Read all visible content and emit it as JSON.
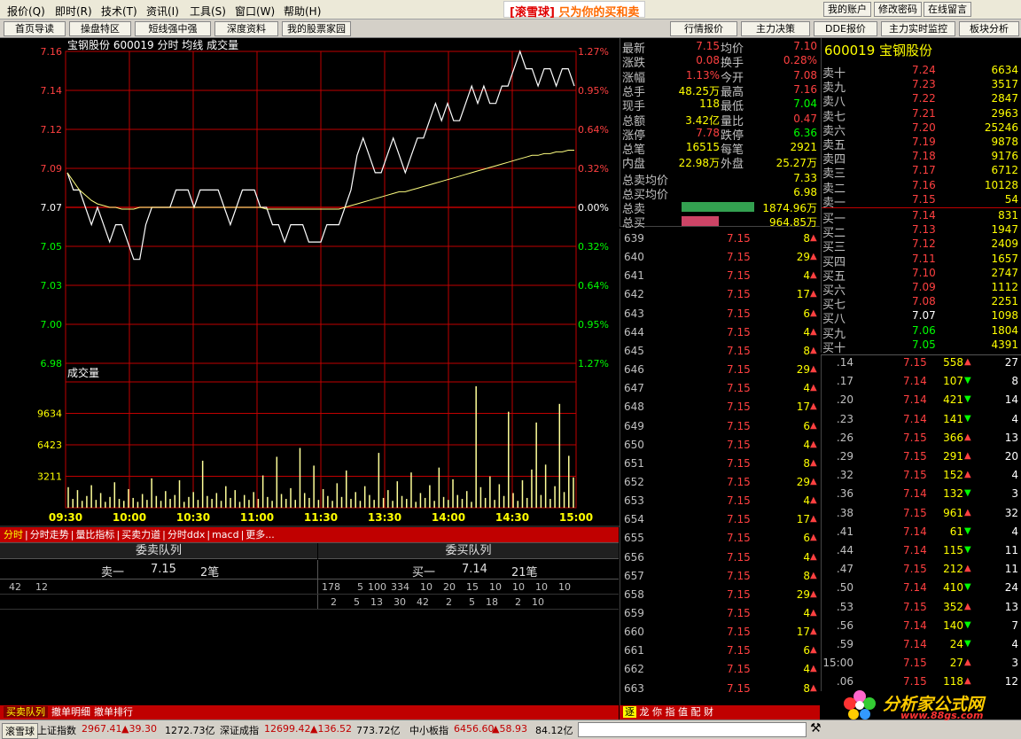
{
  "menu": [
    "报价(Q)",
    "即时(R)",
    "技术(T)",
    "资讯(I)",
    "工具(S)",
    "窗口(W)",
    "帮助(H)"
  ],
  "brand": {
    "name": "[滚雪球]",
    "slogan": "只为你的买和卖"
  },
  "account_buttons": [
    "我的账户",
    "修改密码",
    "在线留言"
  ],
  "toolbar_left": [
    "首页导读",
    "操盘特区",
    "短线强中强",
    "深度资料",
    "我的股票家园"
  ],
  "toolbar_right": [
    "行情报价",
    "主力决策",
    "DDE报价",
    "主力实时监控",
    "板块分析"
  ],
  "chart_data": [
    {
      "type": "line",
      "title": "宝钢股份 600019 分时 均线 成交量",
      "price_ticks": [
        "7.16",
        "7.14",
        "7.12",
        "7.09",
        "7.07",
        "7.05",
        "7.03",
        "7.00",
        "6.98"
      ],
      "pct_ticks": [
        "1.27%",
        "0.95%",
        "0.64%",
        "0.32%",
        "0.00%",
        "0.32%",
        "0.64%",
        "0.95%",
        "1.27%"
      ],
      "x_ticks": [
        "09:30",
        "10:00",
        "10:30",
        "11:00",
        "11:30",
        "13:30",
        "14:00",
        "14:30",
        "15:00"
      ],
      "ylim": [
        6.98,
        7.16
      ],
      "series": [
        {
          "values": [
            7.09,
            7.08,
            7.08,
            7.07,
            7.06,
            7.07,
            7.06,
            7.05,
            7.06,
            7.06,
            7.05,
            7.04,
            7.04,
            7.06,
            7.07,
            7.07,
            7.07,
            7.07,
            7.08,
            7.08,
            7.08,
            7.07,
            7.08,
            7.08,
            7.08,
            7.08,
            7.07,
            7.06,
            7.07,
            7.08,
            7.08,
            7.08,
            7.07,
            7.07,
            7.06,
            7.06,
            7.05,
            7.06,
            7.06,
            7.06,
            7.05,
            7.05,
            7.05,
            7.06,
            7.06,
            7.06,
            7.07,
            7.08,
            7.1,
            7.11,
            7.1,
            7.09,
            7.09,
            7.1,
            7.11,
            7.1,
            7.09,
            7.1,
            7.11,
            7.11,
            7.12,
            7.13,
            7.12,
            7.13,
            7.12,
            7.12,
            7.13,
            7.14,
            7.13,
            7.14,
            7.13,
            7.13,
            7.14,
            7.14,
            7.15,
            7.16,
            7.15,
            7.15,
            7.14,
            7.15,
            7.15,
            7.14,
            7.15,
            7.15,
            7.14
          ]
        },
        {
          "values": [
            7.09,
            7.085,
            7.08,
            7.077,
            7.074,
            7.072,
            7.071,
            7.07,
            7.07,
            7.069,
            7.069,
            7.069,
            7.07,
            7.07,
            7.07,
            7.07,
            7.07,
            7.07,
            7.07,
            7.07,
            7.07,
            7.07,
            7.07,
            7.07,
            7.07,
            7.07,
            7.07,
            7.07,
            7.07,
            7.07,
            7.07,
            7.07,
            7.07,
            7.069,
            7.069,
            7.069,
            7.069,
            7.069,
            7.069,
            7.069,
            7.069,
            7.069,
            7.069,
            7.069,
            7.069,
            7.069,
            7.07,
            7.071,
            7.072,
            7.073,
            7.074,
            7.075,
            7.076,
            7.077,
            7.078,
            7.079,
            7.079,
            7.08,
            7.081,
            7.082,
            7.083,
            7.084,
            7.085,
            7.086,
            7.087,
            7.088,
            7.089,
            7.09,
            7.091,
            7.092,
            7.093,
            7.094,
            7.095,
            7.096,
            7.097,
            7.098,
            7.099,
            7.1,
            7.1,
            7.101,
            7.101,
            7.102,
            7.102,
            7.103,
            7.103
          ]
        }
      ]
    },
    {
      "type": "bar",
      "title": "成交量",
      "y_ticks": [
        "9634",
        "6423",
        "3211"
      ],
      "ylim": [
        0,
        12845
      ],
      "values": [
        2100,
        900,
        1800,
        700,
        1200,
        2300,
        800,
        1500,
        600,
        1100,
        2600,
        900,
        700,
        1900,
        1000,
        600,
        1400,
        800,
        3000,
        1200,
        700,
        1700,
        900,
        1300,
        2800,
        600,
        1100,
        1600,
        800,
        4800,
        1200,
        900,
        1500,
        700,
        2200,
        1000,
        1800,
        600,
        1300,
        800,
        1600,
        900,
        3300,
        1100,
        700,
        5200,
        1400,
        900,
        2000,
        800,
        6100,
        1500,
        1000,
        4300,
        800,
        1900,
        1200,
        700,
        2500,
        1100,
        3800,
        900,
        1600,
        700,
        2200,
        1300,
        800,
        5600,
        1000,
        1800,
        700,
        2700,
        1200,
        900,
        3600,
        600,
        1500,
        1000,
        2300,
        700,
        4100,
        1100,
        800,
        2900,
        1300,
        900,
        1700,
        600,
        12400,
        2100,
        1000,
        3200,
        800,
        2400,
        1200,
        9800,
        1500,
        700,
        2800,
        1000,
        3900,
        8700,
        1300,
        4400,
        900,
        2200,
        10600,
        1600,
        5300,
        3100
      ]
    }
  ],
  "tabs_mid": [
    "分时",
    "分时走势",
    "量比指标",
    "买卖力道",
    "分时ddx",
    "macd",
    "更多..."
  ],
  "queue": {
    "sell_title": "委卖队列",
    "buy_title": "委买队列",
    "sell_label": "卖一",
    "sell_price": "7.15",
    "sell_count": "2笔",
    "buy_label": "买一",
    "buy_price": "7.14",
    "buy_count": "21笔",
    "sell_row": [
      "42",
      "12"
    ],
    "buy_row1": [
      "178",
      "5",
      "100",
      "334",
      "10",
      "20",
      "15",
      "10",
      "10",
      "10",
      "10"
    ],
    "buy_row2": [
      "2",
      "5",
      "13",
      "30",
      "42",
      "2",
      "5",
      "18",
      "2",
      "10"
    ]
  },
  "tabs_bottom": [
    "买卖队列",
    "撤单明细",
    "撤单排行"
  ],
  "status": {
    "btn": "滚雪球",
    "sh": {
      "name": "上证指数",
      "val": "2967.41",
      "chg": "▲39.30",
      "amt": "1272.73亿"
    },
    "sz": {
      "name": "深证成指",
      "val": "12699.42",
      "chg": "▲136.52",
      "amt": "773.72亿"
    },
    "zx": {
      "name": "中小板指",
      "val": "6456.60",
      "chg": "▲58.93",
      "amt": "84.12亿"
    }
  },
  "quote": [
    {
      "l": "最新",
      "v": "7.15",
      "c": "#ff4040",
      "l2": "均价",
      "v2": "7.10",
      "c2": "#ff4040"
    },
    {
      "l": "涨跌",
      "v": "0.08",
      "c": "#ff4040",
      "l2": "换手",
      "v2": "0.28%",
      "c2": "#ff4040"
    },
    {
      "l": "涨幅",
      "v": "1.13%",
      "c": "#ff4040",
      "l2": "今开",
      "v2": "7.08",
      "c2": "#ff4040"
    },
    {
      "l": "总手",
      "v": "48.25万",
      "c": "#ffff00",
      "l2": "最高",
      "v2": "7.16",
      "c2": "#ff4040"
    },
    {
      "l": "现手",
      "v": "118",
      "c": "#ffff00",
      "l2": "最低",
      "v2": "7.04",
      "c2": "#00ff00"
    },
    {
      "l": "总额",
      "v": "3.42亿",
      "c": "#ffff00",
      "l2": "量比",
      "v2": "0.47",
      "c2": "#ff4040"
    },
    {
      "l": "涨停",
      "v": "7.78",
      "c": "#ff4040",
      "l2": "跌停",
      "v2": "6.36",
      "c2": "#00ff00"
    },
    {
      "l": "总笔",
      "v": "16515",
      "c": "#ffff00",
      "l2": "每笔",
      "v2": "2921",
      "c2": "#ffff00"
    },
    {
      "l": "内盘",
      "v": "22.98万",
      "c": "#ffff00",
      "l2": "外盘",
      "v2": "25.27万",
      "c2": "#ffff00"
    }
  ],
  "avg": {
    "sell_label": "总卖均价",
    "sell": "7.33",
    "buy_label": "总买均价",
    "buy": "6.98",
    "tsell_label": "总卖",
    "tsell": "1874.96万",
    "tbuy_label": "总买",
    "tbuy": "964.85万",
    "sell_bar": 1.0,
    "buy_bar": 0.51
  },
  "ticks": [
    {
      "n": "639",
      "p": "7.15",
      "v": "8"
    },
    {
      "n": "640",
      "p": "7.15",
      "v": "29"
    },
    {
      "n": "641",
      "p": "7.15",
      "v": "4"
    },
    {
      "n": "642",
      "p": "7.15",
      "v": "17"
    },
    {
      "n": "643",
      "p": "7.15",
      "v": "6"
    },
    {
      "n": "644",
      "p": "7.15",
      "v": "4"
    },
    {
      "n": "645",
      "p": "7.15",
      "v": "8"
    },
    {
      "n": "646",
      "p": "7.15",
      "v": "29"
    },
    {
      "n": "647",
      "p": "7.15",
      "v": "4"
    },
    {
      "n": "648",
      "p": "7.15",
      "v": "17"
    },
    {
      "n": "649",
      "p": "7.15",
      "v": "6"
    },
    {
      "n": "650",
      "p": "7.15",
      "v": "4"
    },
    {
      "n": "651",
      "p": "7.15",
      "v": "8"
    },
    {
      "n": "652",
      "p": "7.15",
      "v": "29"
    },
    {
      "n": "653",
      "p": "7.15",
      "v": "4"
    },
    {
      "n": "654",
      "p": "7.15",
      "v": "17"
    },
    {
      "n": "655",
      "p": "7.15",
      "v": "6"
    },
    {
      "n": "656",
      "p": "7.15",
      "v": "4"
    },
    {
      "n": "657",
      "p": "7.15",
      "v": "8"
    },
    {
      "n": "658",
      "p": "7.15",
      "v": "29"
    },
    {
      "n": "659",
      "p": "7.15",
      "v": "4"
    },
    {
      "n": "660",
      "p": "7.15",
      "v": "17"
    },
    {
      "n": "661",
      "p": "7.15",
      "v": "6"
    },
    {
      "n": "662",
      "p": "7.15",
      "v": "4"
    },
    {
      "n": "663",
      "p": "7.15",
      "v": "8"
    }
  ],
  "side_tabs": [
    "逐",
    "龙",
    "你",
    "指",
    "值",
    "配",
    "财"
  ],
  "book": {
    "title": "600019 宝钢股份",
    "sells": [
      {
        "l": "卖十",
        "p": "7.24",
        "v": "6634"
      },
      {
        "l": "卖九",
        "p": "7.23",
        "v": "3517"
      },
      {
        "l": "卖八",
        "p": "7.22",
        "v": "2847"
      },
      {
        "l": "卖七",
        "p": "7.21",
        "v": "2963"
      },
      {
        "l": "卖六",
        "p": "7.20",
        "v": "25246"
      },
      {
        "l": "卖五",
        "p": "7.19",
        "v": "9878"
      },
      {
        "l": "卖四",
        "p": "7.18",
        "v": "9176"
      },
      {
        "l": "卖三",
        "p": "7.17",
        "v": "6712"
      },
      {
        "l": "卖二",
        "p": "7.16",
        "v": "10128"
      },
      {
        "l": "卖一",
        "p": "7.15",
        "v": "54"
      }
    ],
    "buys": [
      {
        "l": "买一",
        "p": "7.14",
        "v": "831",
        "pc": "#ff4040"
      },
      {
        "l": "买二",
        "p": "7.13",
        "v": "1947",
        "pc": "#ff4040"
      },
      {
        "l": "买三",
        "p": "7.12",
        "v": "2409",
        "pc": "#ff4040"
      },
      {
        "l": "买四",
        "p": "7.11",
        "v": "1657",
        "pc": "#ff4040"
      },
      {
        "l": "买五",
        "p": "7.10",
        "v": "2747",
        "pc": "#ff4040"
      },
      {
        "l": "买六",
        "p": "7.09",
        "v": "1112",
        "pc": "#ff4040"
      },
      {
        "l": "买七",
        "p": "7.08",
        "v": "2251",
        "pc": "#ff4040"
      },
      {
        "l": "买八",
        "p": "7.07",
        "v": "1098",
        "pc": "#ffffff"
      },
      {
        "l": "买九",
        "p": "7.06",
        "v": "1804",
        "pc": "#00ff00"
      },
      {
        "l": "买十",
        "p": "7.05",
        "v": "4391",
        "pc": "#00ff00"
      }
    ]
  },
  "trades": [
    {
      "t": ".14",
      "p": "7.15",
      "v": "558",
      "d": "up",
      "n": "27"
    },
    {
      "t": ".17",
      "p": "7.14",
      "v": "107",
      "d": "down",
      "n": "8"
    },
    {
      "t": ".20",
      "p": "7.14",
      "v": "421",
      "d": "down",
      "n": "14"
    },
    {
      "t": ".23",
      "p": "7.14",
      "v": "141",
      "d": "down",
      "n": "4"
    },
    {
      "t": ".26",
      "p": "7.15",
      "v": "366",
      "d": "up",
      "n": "13"
    },
    {
      "t": ".29",
      "p": "7.15",
      "v": "291",
      "d": "up",
      "n": "20"
    },
    {
      "t": ".32",
      "p": "7.15",
      "v": "152",
      "d": "up",
      "n": "4"
    },
    {
      "t": ".36",
      "p": "7.14",
      "v": "132",
      "d": "down",
      "n": "3"
    },
    {
      "t": ".38",
      "p": "7.15",
      "v": "961",
      "d": "up",
      "n": "32"
    },
    {
      "t": ".41",
      "p": "7.14",
      "v": "61",
      "d": "down",
      "n": "4"
    },
    {
      "t": ".44",
      "p": "7.14",
      "v": "115",
      "d": "down",
      "n": "11"
    },
    {
      "t": ".47",
      "p": "7.15",
      "v": "212",
      "d": "up",
      "n": "11"
    },
    {
      "t": ".50",
      "p": "7.14",
      "v": "410",
      "d": "down",
      "n": "24"
    },
    {
      "t": ".53",
      "p": "7.15",
      "v": "352",
      "d": "up",
      "n": "13"
    },
    {
      "t": ".56",
      "p": "7.14",
      "v": "140",
      "d": "down",
      "n": "7"
    },
    {
      "t": ".59",
      "p": "7.14",
      "v": "24",
      "d": "down",
      "n": "4"
    },
    {
      "t": "15:00",
      "p": "7.15",
      "v": "27",
      "d": "up",
      "n": "3"
    },
    {
      "t": ".06",
      "p": "7.15",
      "v": "118",
      "d": "up",
      "n": "12"
    }
  ],
  "logo": {
    "name": "分析家公式网",
    "url": "www.88gs.com"
  },
  "colors": {
    "red": "#ff4040",
    "green": "#00ff00",
    "yellow": "#ffff00",
    "grid": "#c00000"
  }
}
